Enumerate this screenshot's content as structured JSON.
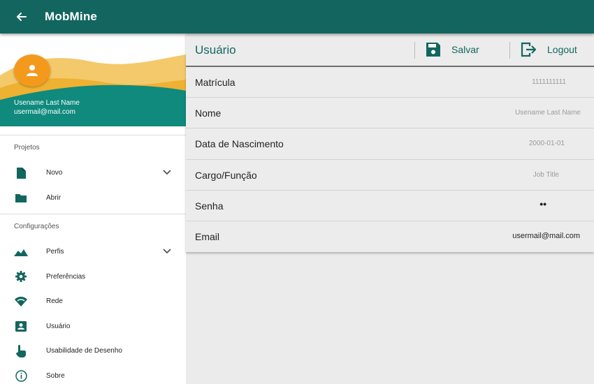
{
  "app": {
    "title": "MobMine"
  },
  "drawer": {
    "user_name": "Usename Last Name",
    "user_email": "usermail@mail.com",
    "sections": [
      {
        "title": "Projetos"
      },
      {
        "title": "Configurações"
      }
    ],
    "projetos_items": [
      {
        "label": "Novo",
        "icon": "file-icon"
      },
      {
        "label": "Abrir",
        "icon": "folder-icon"
      }
    ],
    "config_items": [
      {
        "label": "Perfis",
        "icon": "terrain-icon"
      },
      {
        "label": "Preferências",
        "icon": "gear-icon"
      },
      {
        "label": "Rede",
        "icon": "wifi-icon"
      },
      {
        "label": "Usuário",
        "icon": "user-card-icon"
      },
      {
        "label": "Usabilidade de Desenho",
        "icon": "touch-icon"
      },
      {
        "label": "Sobre",
        "icon": "info-icon"
      }
    ]
  },
  "panel": {
    "title": "Usuário",
    "save_label": "Salvar",
    "logout_label": "Logout",
    "fields": [
      {
        "label": "Matrícula",
        "value": "1111111111"
      },
      {
        "label": "Nome",
        "value": "Usename Last Name"
      },
      {
        "label": "Data de Nascimento",
        "value": "2000-01-01"
      },
      {
        "label": "Cargo/Função",
        "value": "Job Title"
      },
      {
        "label": "Senha",
        "value": "••"
      },
      {
        "label": "Email",
        "value": "usermail@mail.com"
      }
    ]
  },
  "colors": {
    "primary": "#13665f",
    "accent": "#f39a1c",
    "wave_light": "#f4c96b",
    "wave_mid": "#efb131",
    "teal_band": "#0f8a7d"
  }
}
